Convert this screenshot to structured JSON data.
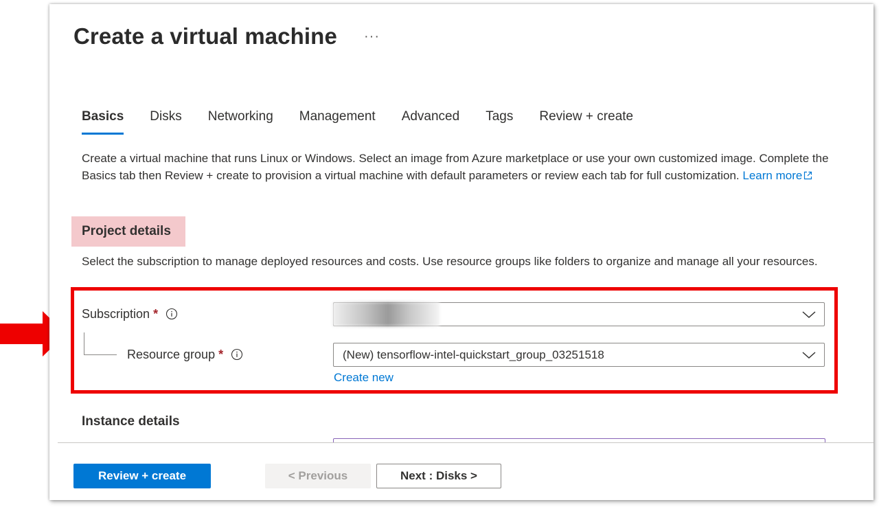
{
  "page": {
    "title": "Create a virtual machine",
    "more": "···"
  },
  "tabs": [
    {
      "label": "Basics",
      "active": true
    },
    {
      "label": "Disks",
      "active": false
    },
    {
      "label": "Networking",
      "active": false
    },
    {
      "label": "Management",
      "active": false
    },
    {
      "label": "Advanced",
      "active": false
    },
    {
      "label": "Tags",
      "active": false
    },
    {
      "label": "Review + create",
      "active": false
    }
  ],
  "intro": {
    "text": "Create a virtual machine that runs Linux or Windows. Select an image from Azure marketplace or use your own customized image. Complete the Basics tab then Review + create to provision a virtual machine with default parameters or review each tab for full customization.",
    "link": "Learn more"
  },
  "project": {
    "title": "Project details",
    "description": "Select the subscription to manage deployed resources and costs. Use resource groups like folders to organize and manage all your resources.",
    "subscription_label": "Subscription",
    "subscription_value": "",
    "resource_group_label": "Resource group",
    "resource_group_value": "(New) tensorflow-intel-quickstart_group_03251518",
    "create_new": "Create new",
    "required_mark": "*"
  },
  "instance": {
    "title": "Instance details"
  },
  "footer": {
    "review_create": "Review + create",
    "previous": "< Previous",
    "next": "Next : Disks >"
  },
  "colors": {
    "accent": "#0078d4",
    "highlight_box": "#ee0000",
    "section_highlight": "#f4c9cc",
    "required": "#a4262c"
  },
  "icons": {
    "info": "info-icon",
    "chevron": "chevron-down-icon",
    "external": "external-link-icon",
    "arrow": "red-arrow-icon"
  }
}
